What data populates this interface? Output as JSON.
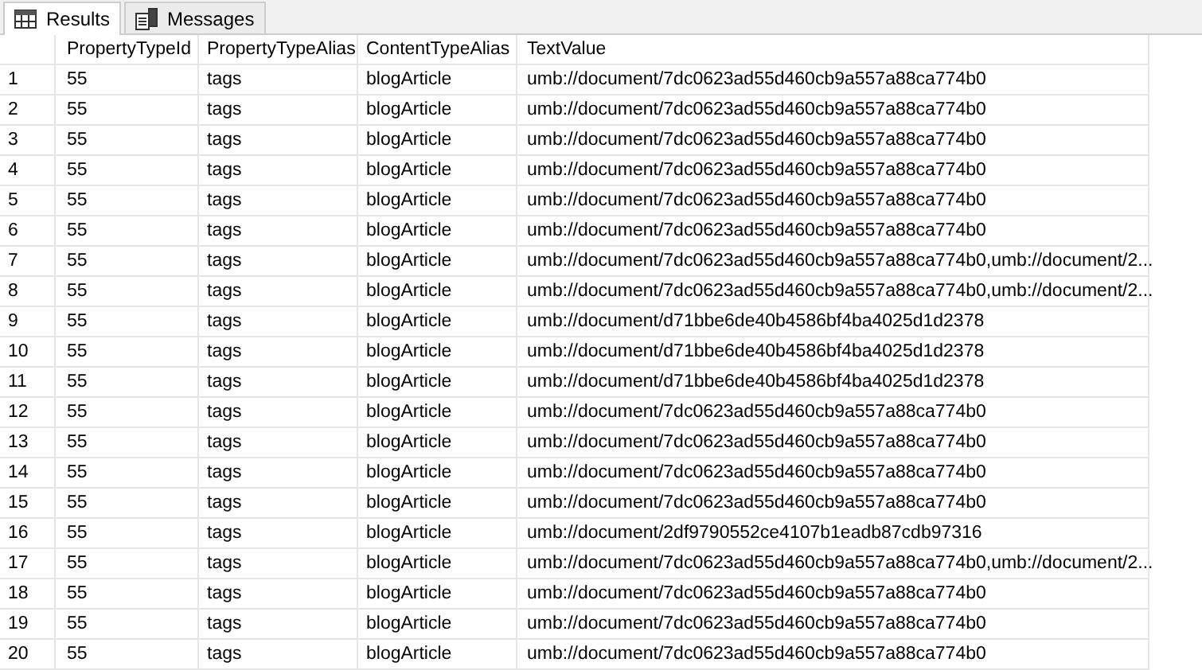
{
  "tabs": [
    {
      "label": "Results",
      "selected": true,
      "kind": "grid"
    },
    {
      "label": "Messages",
      "selected": false,
      "kind": "messages"
    }
  ],
  "table": {
    "columns": [
      "PropertyTypeId",
      "PropertyTypeAlias",
      "ContentTypeAlias",
      "TextValue"
    ],
    "rows": [
      {
        "number": "1",
        "cells": [
          "55",
          "tags",
          "blogArticle",
          "umb://document/7dc0623ad55d460cb9a557a88ca774b0"
        ]
      },
      {
        "number": "2",
        "cells": [
          "55",
          "tags",
          "blogArticle",
          "umb://document/7dc0623ad55d460cb9a557a88ca774b0"
        ]
      },
      {
        "number": "3",
        "cells": [
          "55",
          "tags",
          "blogArticle",
          "umb://document/7dc0623ad55d460cb9a557a88ca774b0"
        ]
      },
      {
        "number": "4",
        "cells": [
          "55",
          "tags",
          "blogArticle",
          "umb://document/7dc0623ad55d460cb9a557a88ca774b0"
        ]
      },
      {
        "number": "5",
        "cells": [
          "55",
          "tags",
          "blogArticle",
          "umb://document/7dc0623ad55d460cb9a557a88ca774b0"
        ]
      },
      {
        "number": "6",
        "cells": [
          "55",
          "tags",
          "blogArticle",
          "umb://document/7dc0623ad55d460cb9a557a88ca774b0"
        ]
      },
      {
        "number": "7",
        "cells": [
          "55",
          "tags",
          "blogArticle",
          "umb://document/7dc0623ad55d460cb9a557a88ca774b0,umb://document/2..."
        ]
      },
      {
        "number": "8",
        "cells": [
          "55",
          "tags",
          "blogArticle",
          "umb://document/7dc0623ad55d460cb9a557a88ca774b0,umb://document/2..."
        ]
      },
      {
        "number": "9",
        "cells": [
          "55",
          "tags",
          "blogArticle",
          "umb://document/d71bbe6de40b4586bf4ba4025d1d2378"
        ]
      },
      {
        "number": "10",
        "cells": [
          "55",
          "tags",
          "blogArticle",
          "umb://document/d71bbe6de40b4586bf4ba4025d1d2378"
        ]
      },
      {
        "number": "11",
        "cells": [
          "55",
          "tags",
          "blogArticle",
          "umb://document/d71bbe6de40b4586bf4ba4025d1d2378"
        ]
      },
      {
        "number": "12",
        "cells": [
          "55",
          "tags",
          "blogArticle",
          "umb://document/7dc0623ad55d460cb9a557a88ca774b0"
        ]
      },
      {
        "number": "13",
        "cells": [
          "55",
          "tags",
          "blogArticle",
          "umb://document/7dc0623ad55d460cb9a557a88ca774b0"
        ]
      },
      {
        "number": "14",
        "cells": [
          "55",
          "tags",
          "blogArticle",
          "umb://document/7dc0623ad55d460cb9a557a88ca774b0"
        ]
      },
      {
        "number": "15",
        "cells": [
          "55",
          "tags",
          "blogArticle",
          "umb://document/7dc0623ad55d460cb9a557a88ca774b0"
        ]
      },
      {
        "number": "16",
        "cells": [
          "55",
          "tags",
          "blogArticle",
          "umb://document/2df9790552ce4107b1eadb87cdb97316"
        ]
      },
      {
        "number": "17",
        "cells": [
          "55",
          "tags",
          "blogArticle",
          "umb://document/7dc0623ad55d460cb9a557a88ca774b0,umb://document/2..."
        ]
      },
      {
        "number": "18",
        "cells": [
          "55",
          "tags",
          "blogArticle",
          "umb://document/7dc0623ad55d460cb9a557a88ca774b0"
        ]
      },
      {
        "number": "19",
        "cells": [
          "55",
          "tags",
          "blogArticle",
          "umb://document/7dc0623ad55d460cb9a557a88ca774b0"
        ]
      },
      {
        "number": "20",
        "cells": [
          "55",
          "tags",
          "blogArticle",
          "umb://document/7dc0623ad55d460cb9a557a88ca774b0"
        ]
      }
    ]
  }
}
